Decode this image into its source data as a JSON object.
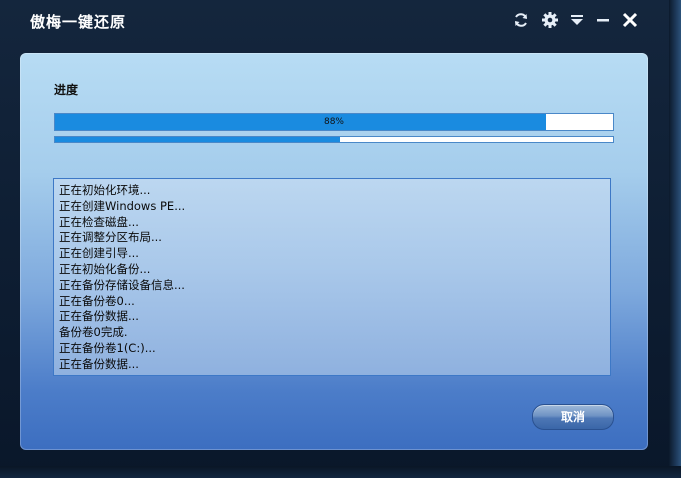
{
  "window": {
    "title": "傲梅一键还原"
  },
  "titlebar": {
    "icons": [
      "refresh-icon",
      "gear-icon",
      "dropdown-menu-icon",
      "minimize-icon",
      "close-icon"
    ]
  },
  "progress": {
    "label": "进度",
    "main_percent_text": "88%",
    "main_fraction": 0.88,
    "secondary_fraction": 0.51
  },
  "log": {
    "lines": [
      "正在初始化环境...",
      "正在创建Windows PE...",
      "正在检查磁盘...",
      "正在调整分区布局...",
      "正在创建引导...",
      "正在初始化备份...",
      "正在备份存储设备信息...",
      "正在备份卷0...",
      "正在备份数据...",
      "备份卷0完成.",
      "正在备份卷1(C:)...",
      "正在备份数据..."
    ]
  },
  "buttons": {
    "cancel_label": "取消"
  },
  "colors": {
    "accent": "#1a8be0",
    "panel_top": "#b7dcf4",
    "panel_bottom": "#3c6ec0"
  }
}
